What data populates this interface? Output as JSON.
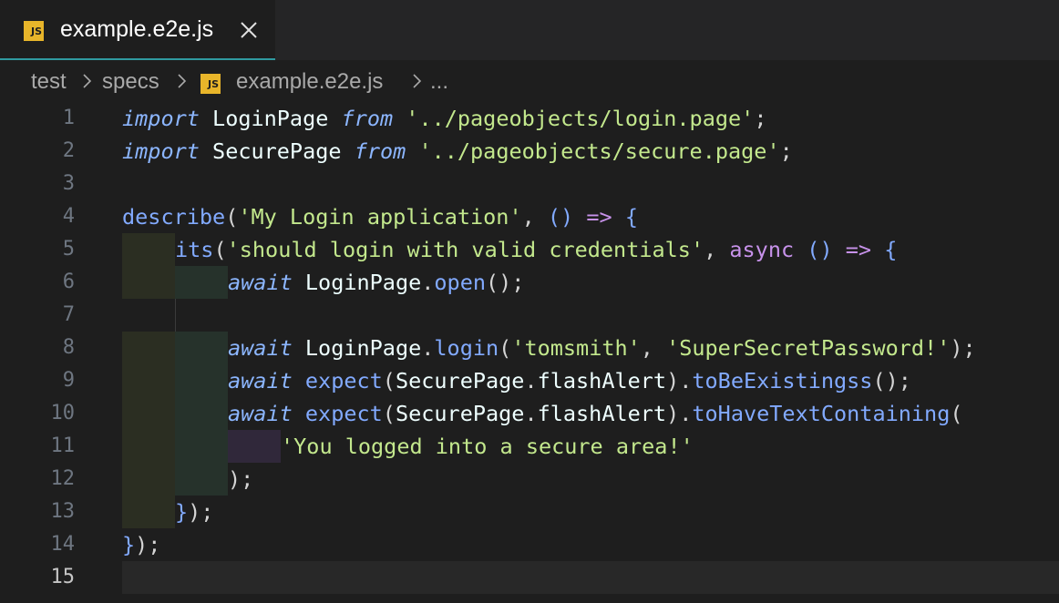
{
  "tab": {
    "label": "example.e2e.js",
    "badge": "JS"
  },
  "breadcrumb": {
    "items": [
      "test",
      "specs"
    ],
    "file": "example.e2e.js",
    "ellipsis": "...",
    "badge": "JS"
  },
  "editor": {
    "line_numbers": [
      "1",
      "2",
      "3",
      "4",
      "5",
      "6",
      "7",
      "8",
      "9",
      "10",
      "11",
      "12",
      "13",
      "14",
      "15"
    ],
    "current_line": 15,
    "tokens": {
      "import": "import",
      "from": "from",
      "login_page": "LoginPage",
      "secure_page": "SecurePage",
      "path_login": "'../pageobjects/login.page'",
      "path_secure": "'../pageobjects/secure.page'",
      "semi": ";",
      "describe": "describe",
      "describe_title": "'My Login application'",
      "its": "its",
      "its_title": "'should login with valid credentials'",
      "async": "async",
      "await": "await",
      "open": "open",
      "login": "login",
      "username": "'tomsmith'",
      "password": "'SuperSecretPassword!'",
      "expect": "expect",
      "flash_alert": "flashAlert",
      "to_be_existing": "toBeExistingss",
      "to_have_text": "toHaveTextContaining",
      "message": "'You logged into a secure area!'"
    }
  }
}
